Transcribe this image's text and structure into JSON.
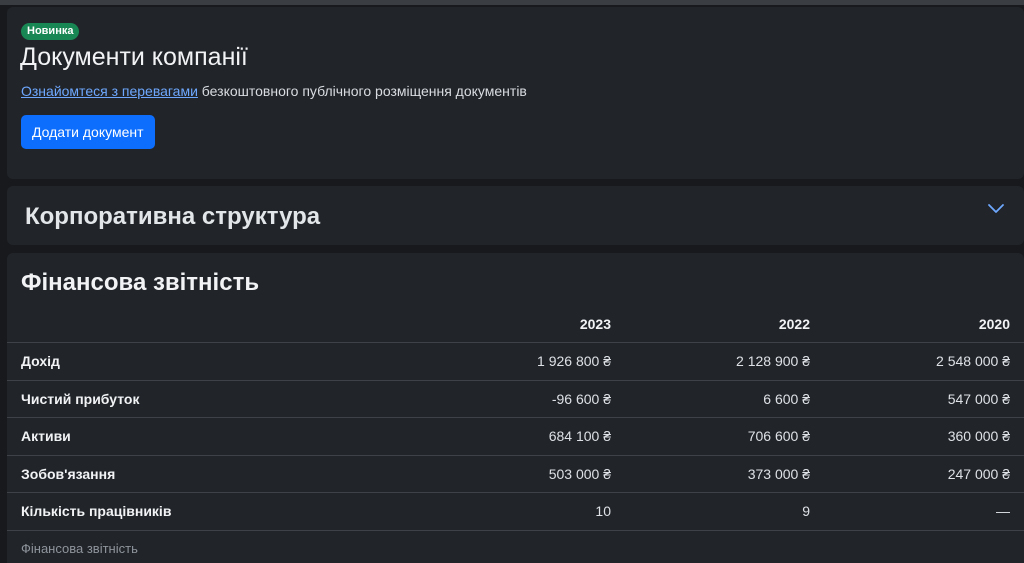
{
  "documents": {
    "badge": "Новинка",
    "title": "Документи компанії",
    "link_text": "Ознайомтеся з перевагами",
    "description": " безкоштовного публічного розміщення документів",
    "add_button": "Додати документ"
  },
  "corporate": {
    "title": "Корпоративна структура",
    "icon": "chevron-down-icon"
  },
  "financial": {
    "title": "Фінансова звітність",
    "years": [
      "2023",
      "2022",
      "2020"
    ],
    "rows": [
      {
        "label": "Дохід",
        "values": [
          "1 926 800 ₴",
          "2 128 900 ₴",
          "2 548 000 ₴"
        ]
      },
      {
        "label": "Чистий прибуток",
        "values": [
          "-96 600 ₴",
          "6 600 ₴",
          "547 000 ₴"
        ]
      },
      {
        "label": "Активи",
        "values": [
          "684 100 ₴",
          "706 600 ₴",
          "360 000 ₴"
        ]
      },
      {
        "label": "Зобов'язання",
        "values": [
          "503 000 ₴",
          "373 000 ₴",
          "247 000 ₴"
        ]
      },
      {
        "label": "Кількість працівників",
        "values": [
          "10",
          "9",
          "—"
        ]
      }
    ],
    "caption": "Фінансова звітність"
  },
  "colors": {
    "background": "#17191c",
    "card": "#212429",
    "badge": "#198754",
    "primary_button": "#0d6efd",
    "link": "#6ea8fe"
  }
}
